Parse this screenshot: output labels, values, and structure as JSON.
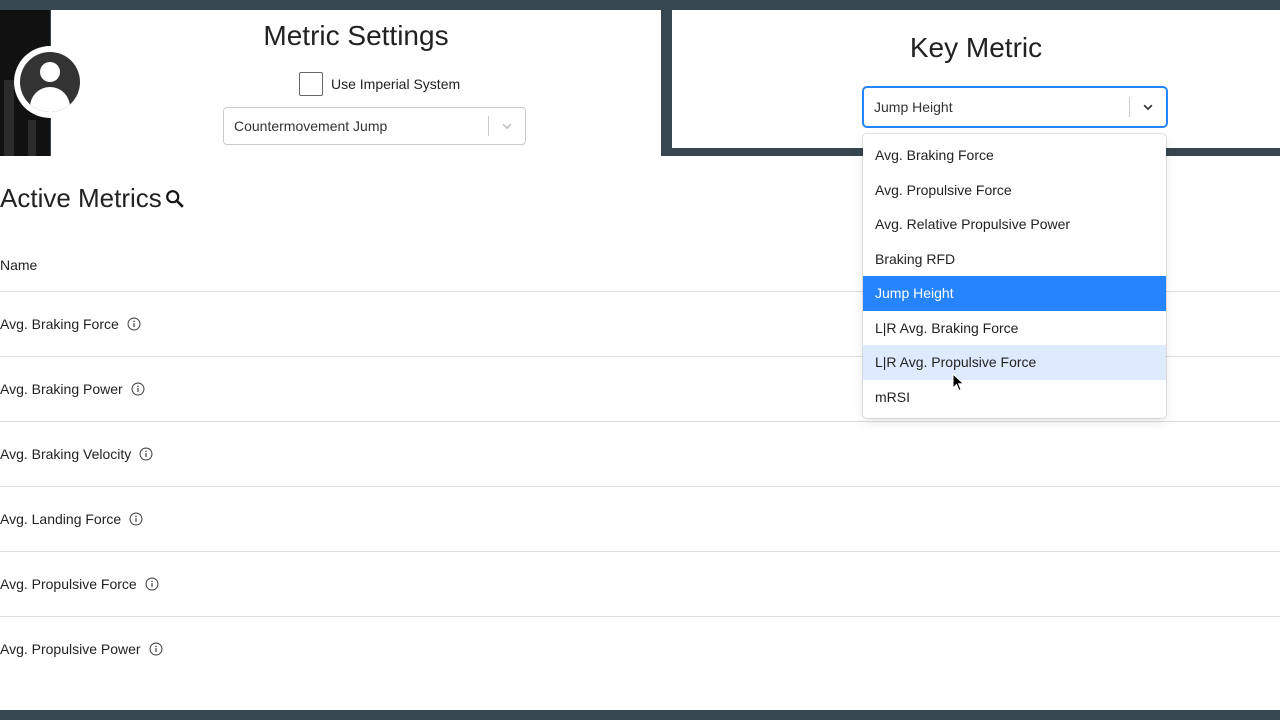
{
  "metric_settings": {
    "title": "Metric Settings",
    "imperial_label": "Use Imperial System",
    "imperial_checked": false,
    "test_type": "Countermovement Jump"
  },
  "key_metric": {
    "title": "Key Metric",
    "selected": "Jump Height",
    "options": [
      "Avg. Braking Force",
      "Avg. Propulsive Force",
      "Avg. Relative Propulsive Power",
      "Braking RFD",
      "Jump Height",
      "L|R Avg. Braking Force",
      "L|R Avg. Propulsive Force",
      "mRSI"
    ],
    "hovered": "L|R Avg. Propulsive Force"
  },
  "active_metrics": {
    "title": "Active Metrics",
    "column_name": "Name",
    "rows": [
      "Avg. Braking Force",
      "Avg. Braking Power",
      "Avg. Braking Velocity",
      "Avg. Landing Force",
      "Avg. Propulsive Force",
      "Avg. Propulsive Power"
    ]
  },
  "colors": {
    "accent": "#2684ff",
    "hover": "#deebff",
    "frame": "#37474f"
  }
}
